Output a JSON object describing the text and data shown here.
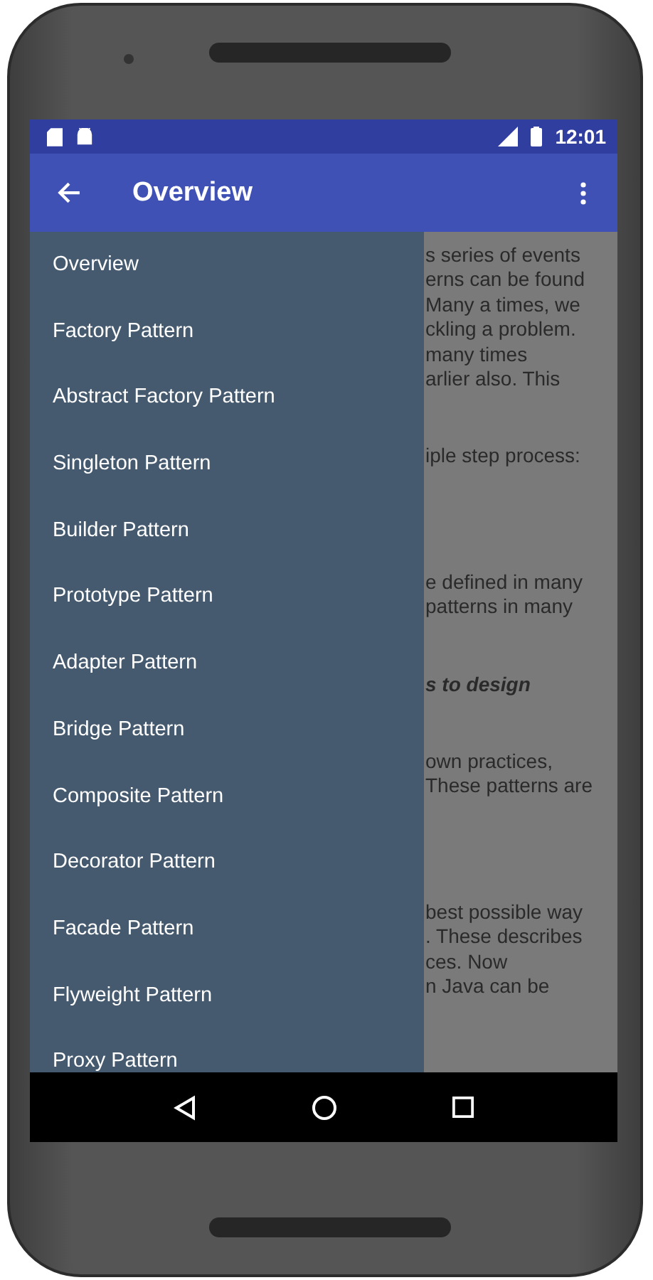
{
  "status_bar": {
    "time": "12:01"
  },
  "toolbar": {
    "title": "Overview"
  },
  "content": {
    "paragraphs": [
      {
        "kind": "plain",
        "lines": [
          "s series of events",
          "erns can be found",
          "Many a times, we",
          "ckling a problem.",
          "many times",
          "arlier also. This"
        ]
      },
      {
        "kind": "plain",
        "lines": [
          "iple step process:"
        ]
      },
      {
        "kind": "plain",
        "lines": [
          "e defined in many",
          "patterns in many"
        ]
      },
      {
        "kind": "emphasis",
        "lines": [
          "s to design"
        ]
      },
      {
        "kind": "plain",
        "lines": [
          "own practices,",
          "These patterns are"
        ]
      },
      {
        "kind": "plain",
        "lines": [
          "best possible way",
          ". These describes",
          "ces. Now",
          "n Java can be"
        ]
      }
    ]
  },
  "drawer": {
    "items": [
      "Overview",
      "Factory Pattern",
      "Abstract Factory Pattern",
      "Singleton Pattern",
      "Builder Pattern",
      "Prototype Pattern",
      "Adapter Pattern",
      "Bridge Pattern",
      "Composite Pattern",
      "Decorator Pattern",
      "Facade Pattern",
      "Flyweight Pattern",
      "Proxy Pattern"
    ]
  }
}
